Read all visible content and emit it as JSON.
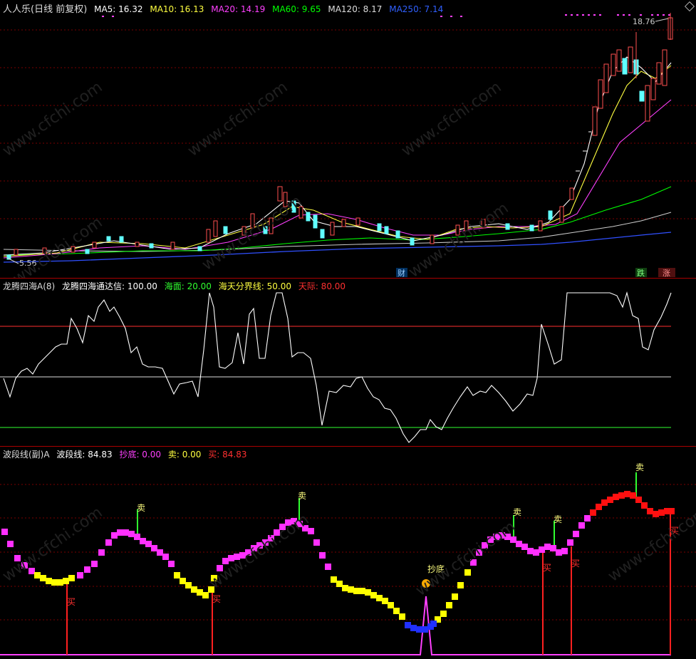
{
  "main_header": {
    "title": "人人乐(日线 前复权)",
    "ma5_label": "MA5: 16.32",
    "ma10_label": "MA10: 16.13",
    "ma20_label": "MA20: 14.19",
    "ma60_label": "MA60: 9.65",
    "ma120_label": "MA120: 8.17",
    "ma250_label": "MA250: 7.14",
    "high_price": "18.76",
    "low_price": "5.56",
    "colors": {
      "ma5": "#ffffff",
      "ma10": "#ffff00",
      "ma20": "#ff40ff",
      "ma60": "#00ff00",
      "ma120": "#dddddd",
      "ma250": "#3060ff"
    }
  },
  "main_markers": {
    "cai": "财",
    "die": "跌",
    "zhang": "涨"
  },
  "ind1_header": {
    "name": "龙腾四海A(8)",
    "signal": "龙腾四海通达信: 100.00",
    "haimian": "海面: 20.00",
    "haitian": "海天分界线: 50.00",
    "tianji": "天际: 80.00"
  },
  "ind2_header": {
    "name": "波段线(副)A",
    "bodaxian": "波段线: 84.83",
    "chaodi": "抄底: 0.00",
    "mai_sell": "卖: 0.00",
    "mai_buy": "买: 84.83"
  },
  "ind2_marks": {
    "sell": "卖",
    "buy": "买",
    "bottom": "抄底"
  },
  "watermark": "www.cfchi.com"
}
